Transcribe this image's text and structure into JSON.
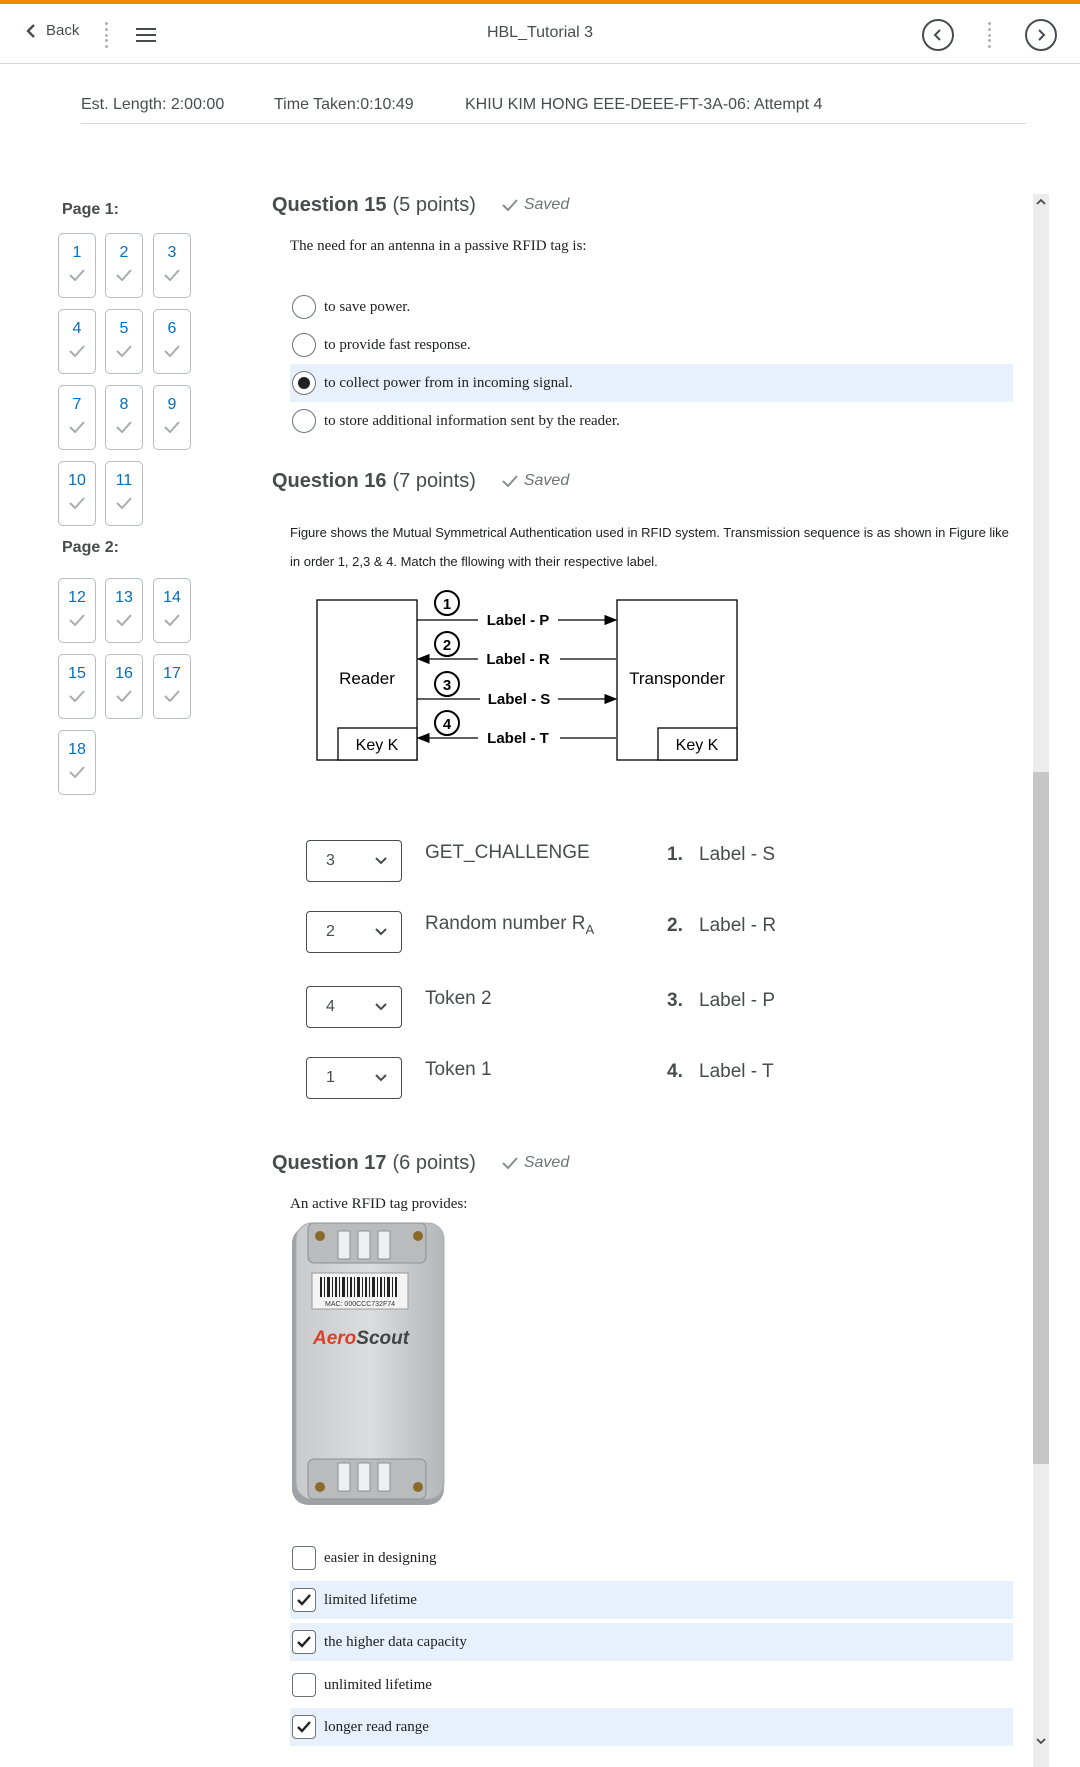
{
  "header": {
    "back_label": "Back",
    "title": "HBL_Tutorial 3"
  },
  "info": {
    "est_length": "Est. Length: 2:00:00",
    "time_taken": "Time Taken:0:10:49",
    "attempt": "KHIU KIM HONG EEE-DEEE-FT-3A-06: Attempt 4"
  },
  "nav": {
    "page1": "Page 1:",
    "page2": "Page 2:",
    "questions": [
      "1",
      "2",
      "3",
      "4",
      "5",
      "6",
      "7",
      "8",
      "9",
      "10",
      "11",
      "12",
      "13",
      "14",
      "15",
      "16",
      "17",
      "18"
    ]
  },
  "q15": {
    "number": "Question 15",
    "points": "(5 points)",
    "saved": "Saved",
    "text": "The need for an antenna in a passive RFID tag is:",
    "options": [
      "to save power.",
      "to provide fast response.",
      "to collect power from in incoming signal.",
      "to store additional information sent by the reader."
    ],
    "selected_index": 2
  },
  "q16": {
    "number": "Question 16",
    "points": "(7 points)",
    "saved": "Saved",
    "desc": "Figure shows the Mutual Symmetrical Authentication used in RFID system. Transmission sequence is as shown in Figure like in order 1, 2,3 & 4. Match the fllowing with their respective label.",
    "figure": {
      "reader": "Reader",
      "transponder": "Transponder",
      "key": "Key K",
      "steps": [
        "1",
        "2",
        "3",
        "4"
      ],
      "labels": [
        "Label - P",
        "Label - R",
        "Label - S",
        "Label - T"
      ]
    },
    "matches": [
      {
        "value": "3",
        "item": "GET_CHALLENGE"
      },
      {
        "value": "2",
        "item": "Random number R",
        "sub": "A"
      },
      {
        "value": "4",
        "item": "Token 2"
      },
      {
        "value": "1",
        "item": "Token 1"
      }
    ],
    "choices": [
      {
        "num": "1.",
        "label": "Label - S"
      },
      {
        "num": "2.",
        "label": "Label - R"
      },
      {
        "num": "3.",
        "label": "Label - P"
      },
      {
        "num": "4.",
        "label": "Label - T"
      }
    ]
  },
  "q17": {
    "number": "Question 17",
    "points": "(6 points)",
    "saved": "Saved",
    "text": "An active RFID tag provides:",
    "tag_mac": "MAC: 000CCC732F74",
    "tag_brand_a": "Aero",
    "tag_brand_b": "Scout",
    "options": [
      {
        "label": "easier in designing",
        "checked": false
      },
      {
        "label": "limited lifetime",
        "checked": true
      },
      {
        "label": "the higher data capacity",
        "checked": true
      },
      {
        "label": "unlimited lifetime",
        "checked": false
      },
      {
        "label": "longer read range",
        "checked": true
      }
    ]
  },
  "colors": {
    "accent": "#f18a00",
    "link": "#006fbf",
    "selected_bg": "#e8f1fb"
  }
}
